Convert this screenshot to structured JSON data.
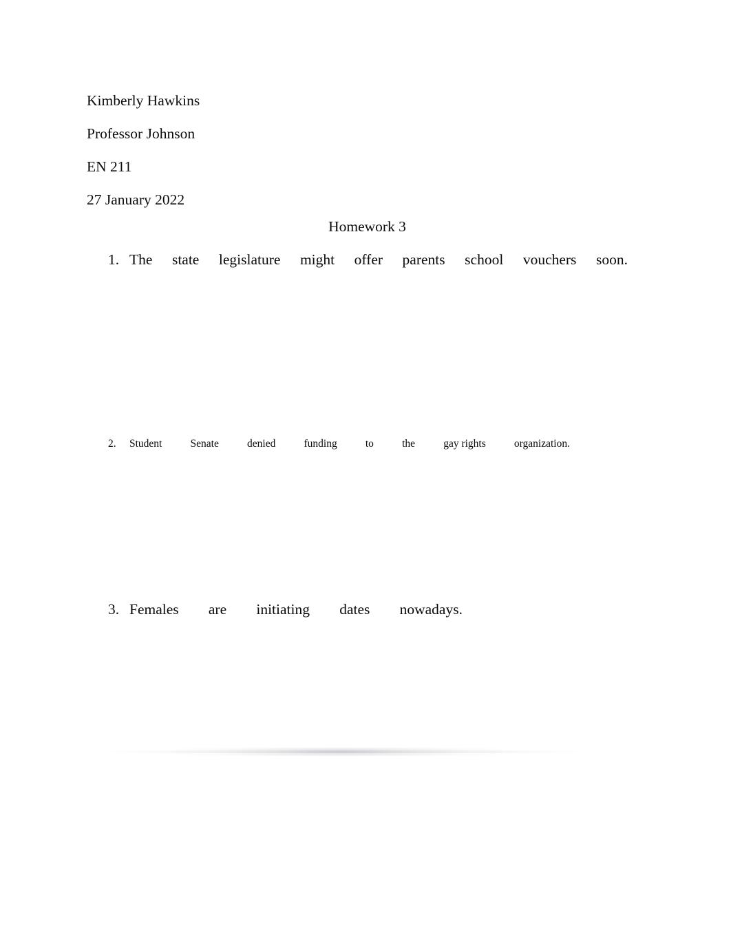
{
  "document": {
    "background_color": "#ffffff",
    "text_color": "#000000"
  },
  "heading": {
    "student_name": "Kimberly Hawkins",
    "instructor": "Professor Johnson",
    "course": "EN 211",
    "date": "27 January 2022"
  },
  "title": "Homework 3",
  "questions": [
    {
      "marker": "1.",
      "size": "large",
      "words": [
        "The",
        "state",
        "legislature",
        "might",
        "offer",
        "parents",
        "school",
        "vouchers",
        "soon."
      ]
    },
    {
      "marker": "2.",
      "size": "small",
      "words": [
        "Student",
        "Senate",
        "denied",
        "funding",
        "to",
        "the",
        "gay rights",
        "organization."
      ]
    },
    {
      "marker": "3.",
      "size": "large",
      "words": [
        "Females",
        "are",
        "initiating",
        "dates",
        "nowadays."
      ]
    }
  ]
}
